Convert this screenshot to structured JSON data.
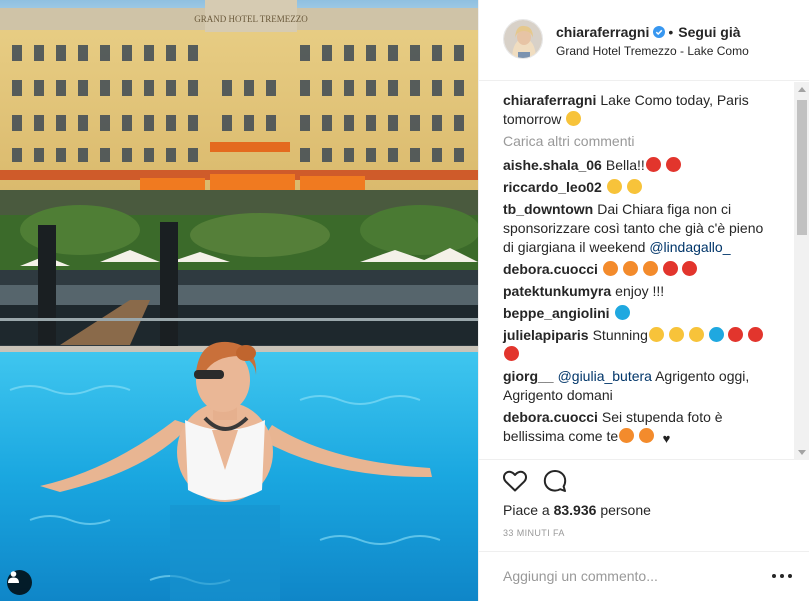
{
  "post": {
    "username": "chiaraferragni",
    "follow_label": "Segui già",
    "separator": "•",
    "location": "Grand Hotel Tremezzo - Lake Como",
    "hotel_sign": "GRAND HOTEL TREMEZZO",
    "caption_user": "chiaraferragni",
    "caption_text": "Lake Como today, Paris tomorrow"
  },
  "load_more_label": "Carica altri commenti",
  "comments": [
    {
      "user": "aishe.shala_06",
      "text": "Bella!!"
    },
    {
      "user": "riccardo_leo02",
      "text": ""
    },
    {
      "user": "tb_downtown",
      "text": "Dai Chiara figa non ci sponsorizzare così tanto che già c'è pieno di giargiana il weekend",
      "mention": "@lindagallo_"
    },
    {
      "user": "debora.cuocci",
      "text": ""
    },
    {
      "user": "patektunkumyra",
      "text": "enjoy !!!"
    },
    {
      "user": "beppe_angiolini",
      "text": ""
    },
    {
      "user": "julielapiparis",
      "text": "Stunning"
    },
    {
      "user": "giorg__",
      "mention": "@giulia_butera",
      "text": "Agrigento oggi, Agrigento domani"
    },
    {
      "user": "debora.cuocci",
      "text": "Sei stupenda foto è bellissima come te"
    }
  ],
  "likes_label": "Piace a",
  "likes_count": "83.936",
  "likes_suffix": "persone",
  "timestamp": "33 MINUTI FA",
  "add_comment_placeholder": "Aggiungi un commento...",
  "icons": {
    "like": "heart-outline-icon",
    "comment": "speech-bubble-icon",
    "more": "ellipsis-icon",
    "verified": "verified-badge-icon",
    "user_tag": "user-tag-icon"
  },
  "colors": {
    "username": "#262626",
    "mention": "#003569",
    "muted": "#999999",
    "verified": "#3897f0",
    "pool": "#1fa8e0"
  }
}
